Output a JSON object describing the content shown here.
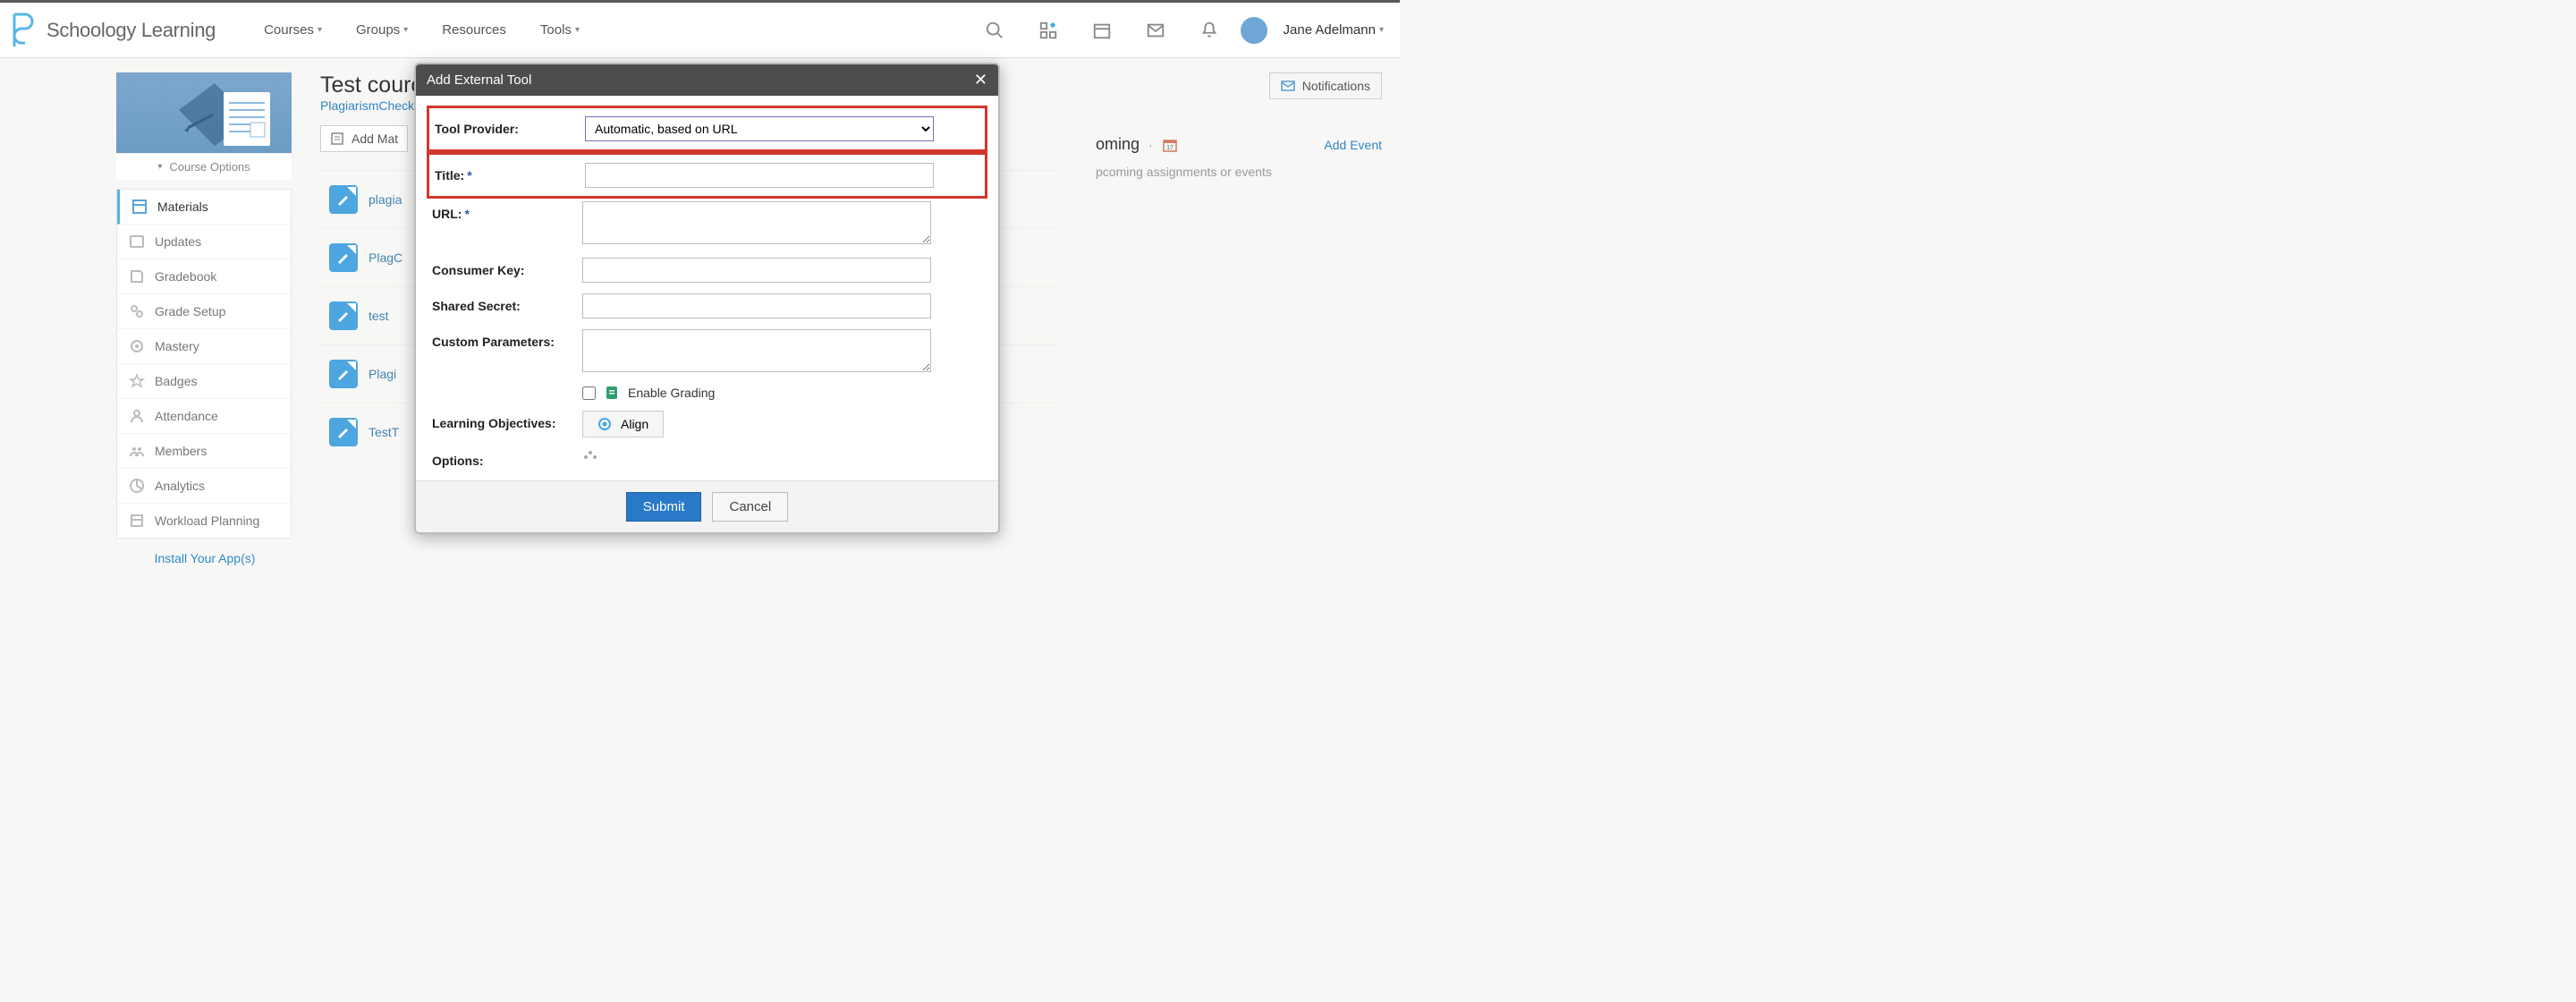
{
  "brand": "Schoology Learning",
  "nav": {
    "courses": "Courses",
    "groups": "Groups",
    "resources": "Resources",
    "tools": "Tools"
  },
  "user": {
    "name": "Jane Adelmann"
  },
  "sidebar": {
    "course_options": "Course Options",
    "items": [
      {
        "label": "Materials",
        "icon": "materials-icon",
        "active": true
      },
      {
        "label": "Updates",
        "icon": "updates-icon"
      },
      {
        "label": "Gradebook",
        "icon": "gradebook-icon"
      },
      {
        "label": "Grade Setup",
        "icon": "grade-setup-icon"
      },
      {
        "label": "Mastery",
        "icon": "mastery-icon"
      },
      {
        "label": "Badges",
        "icon": "badges-icon"
      },
      {
        "label": "Attendance",
        "icon": "attendance-icon"
      },
      {
        "label": "Members",
        "icon": "members-icon"
      },
      {
        "label": "Analytics",
        "icon": "analytics-icon"
      },
      {
        "label": "Workload Planning",
        "icon": "workload-icon"
      }
    ],
    "install_link": "Install Your App(s)"
  },
  "course": {
    "title": "Test cource",
    "subtitle_link": "PlagiarismCheck.o",
    "add_materials": "Add Mat",
    "materials": [
      {
        "name": "plagia"
      },
      {
        "name": "PlagC"
      },
      {
        "name": "test"
      },
      {
        "name": "Plagi"
      },
      {
        "name": "TestT"
      }
    ]
  },
  "notifications_btn": "Notifications",
  "upcoming": {
    "heading": "oming",
    "add_event": "Add Event",
    "empty_text": "pcoming assignments or events"
  },
  "modal": {
    "title": "Add External Tool",
    "labels": {
      "provider": "Tool Provider:",
      "title": "Title:",
      "url": "URL:",
      "consumer_key": "Consumer Key:",
      "shared_secret": "Shared Secret:",
      "custom_parameters": "Custom Parameters:",
      "enable_grading": "Enable Grading",
      "learning_objectives": "Learning Objectives:",
      "align": "Align",
      "options": "Options:"
    },
    "provider_selected": "Automatic, based on URL",
    "submit": "Submit",
    "cancel": "Cancel"
  }
}
